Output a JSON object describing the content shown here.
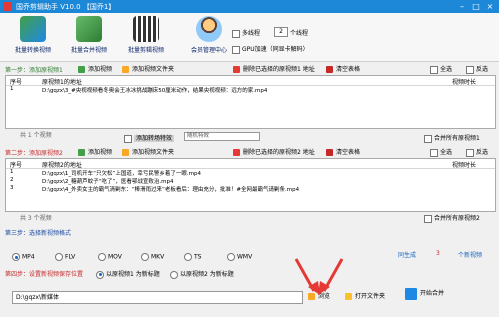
{
  "window": {
    "title": "国乔剪辑助手 V10.0  【国乔1】"
  },
  "toolbar": {
    "buttons": [
      {
        "label": "批量转换视频"
      },
      {
        "label": "批量合并视频"
      },
      {
        "label": "批量剪辑视频"
      },
      {
        "label": "会员管理中心"
      }
    ],
    "multithread_label": "多线程",
    "thread_count": "2",
    "thread_unit": "个线程",
    "gpu_label": "GPU加速（同显卡解码）"
  },
  "step1": {
    "label": "第一步：添加原视频1",
    "add_video": "添加视频",
    "add_folder": "添加视频文件夹",
    "delete_selected": "删除已选择的原视频1 地址",
    "clear_table": "清空表格",
    "select_all": "全选",
    "invert": "反选",
    "columns": [
      "序号",
      "原视频1的地址",
      "视频时长"
    ],
    "rows": [
      {
        "index": "1",
        "path": "D:\\gqzx\\3_#央视视频看冬奥会王冰冰挑战蹦床50厘米动作，结果央视视频：远方的家.mp4",
        "duration": ""
      }
    ],
    "count": "共 1 个视频"
  },
  "merge": {
    "add_transition": "添加转场特效",
    "transition_select": "随机特效",
    "merge_all": "合并所有原视频1"
  },
  "step2": {
    "label": "第二步：添加原视频2",
    "add_video": "添加视频",
    "add_folder": "添加视频文件夹",
    "delete_selected": "删除已选择的原视频2 地址",
    "clear_table": "清空表格",
    "select_all": "全选",
    "invert": "反选",
    "columns": [
      "序号",
      "原视频2的地址",
      "视频时长"
    ],
    "rows": [
      {
        "index": "1",
        "path": "D:\\gqzx\\1_司机开车“只欠松”上国道，幸亏民警乡着了一眼.mp4",
        "duration": ""
      },
      {
        "index": "2",
        "path": "D:\\gqzx\\2_糖葫芦蚊子“吃了”，医看鄂战宣败治.mp4",
        "duration": ""
      },
      {
        "index": "3",
        "path": "D:\\gqzx\\4_外卖女主的霸气清剿东：“棒滑雨过来”老板看后：理由充分，批准！#全网最霸气请剿条.mp4",
        "duration": ""
      }
    ],
    "count": "共 3 个视频",
    "merge_all": "合并所有原视频2"
  },
  "step3": {
    "label": "第三步：选择新视频格式",
    "formats": [
      "MP4",
      "FLV",
      "MOV",
      "MKV",
      "TS",
      "WMV"
    ],
    "selected": "MP4",
    "generate_label": "同生成",
    "generate_count": "3",
    "generate_unit": "个新视频"
  },
  "step4": {
    "label": "第四步：设置新视频保存位置",
    "option1": "以原视频1 为新标题",
    "option2": "以原视频2 为新标题",
    "path": "D:\\gqzx\\新媒体",
    "browse": "浏览",
    "open_folder": "打开文件夹",
    "start": "开始合并"
  }
}
